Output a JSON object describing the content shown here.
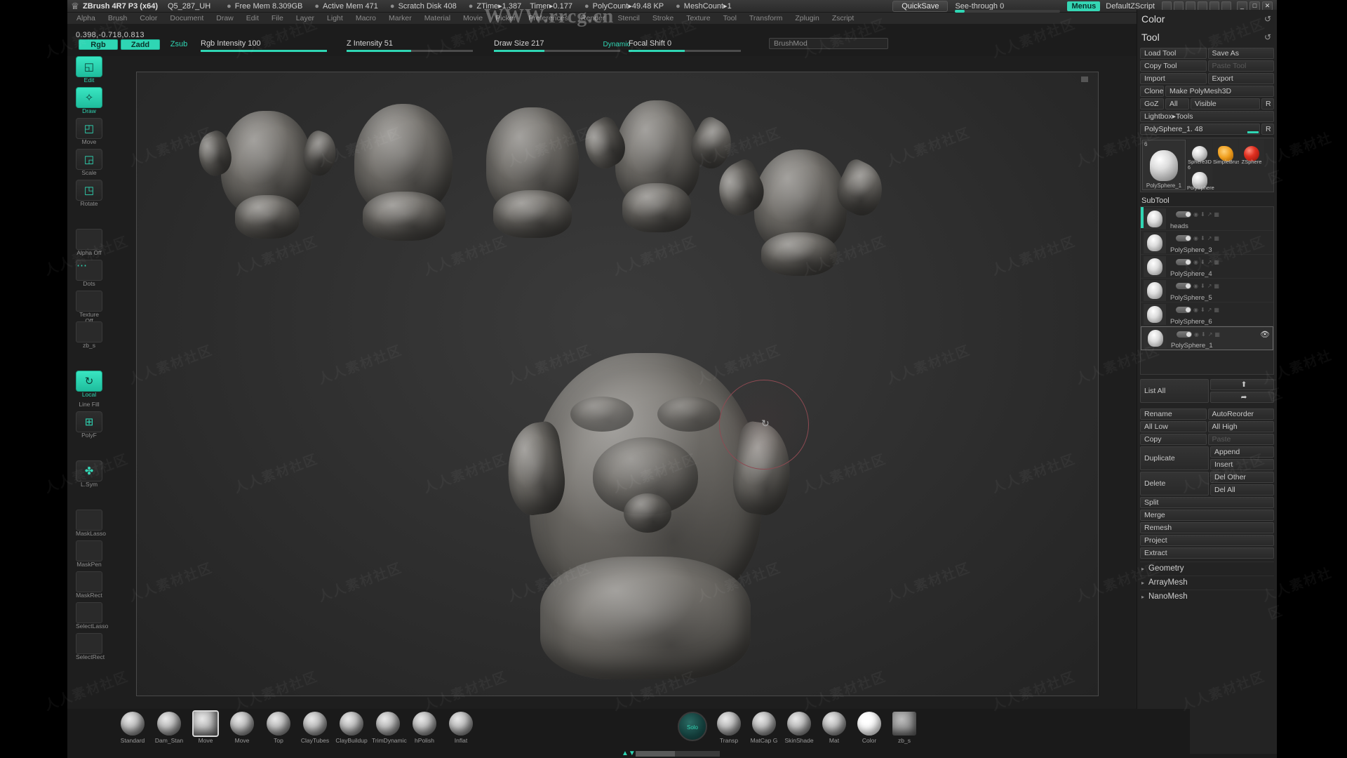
{
  "titlebar": {
    "app": "ZBrush 4R7 P3 (x64)",
    "project": "Q5_287_UH",
    "free_mem": "Free Mem 8.309GB",
    "active_mem": "Active Mem 471",
    "scratch_disk": "Scratch Disk 408",
    "ztime": "ZTime▸1.387",
    "timer": "Timer▸0.177",
    "polycount": "PolyCount▸49.48 KP",
    "meshcount": "MeshCount▸1",
    "quicksave": "QuickSave",
    "see_through_label": "See-through",
    "see_through_value": "0",
    "menus": "Menus",
    "zscript": "DefaultZScript",
    "win_min": "_",
    "win_max": "□",
    "win_close": "✕"
  },
  "menubar": {
    "items": [
      "Alpha",
      "Brush",
      "Color",
      "Document",
      "Draw",
      "Edit",
      "File",
      "Layer",
      "Light",
      "Macro",
      "Marker",
      "Material",
      "Movie",
      "Picker",
      "Preferences",
      "Render",
      "Stencil",
      "Stroke",
      "Texture",
      "Tool",
      "Transform",
      "Zplugin",
      "Zscript"
    ]
  },
  "watermark": {
    "url": "WWW.rrcg.cn",
    "tile": "人人素材社区"
  },
  "coords": "0.398,-0.718,0.813",
  "toolbar2": {
    "rgb": "Rgb",
    "zadd": "Zadd",
    "zsub": "Zsub",
    "rgb_intensity": "Rgb Intensity 100",
    "z_intensity": "Z Intensity 51",
    "draw_size": "Draw Size 217",
    "dynamic": "Dynamic",
    "focal_shift": "Focal Shift 0",
    "brushmod": "BrushMod"
  },
  "left_strip": {
    "items": [
      {
        "label": "Edit",
        "icon": "edit-icon",
        "glyph": "◱",
        "active": true,
        "type": "button"
      },
      {
        "label": "Draw",
        "icon": "draw-icon",
        "glyph": "✧",
        "active": true,
        "type": "button"
      },
      {
        "label": "Move",
        "icon": "move-icon",
        "glyph": "◰",
        "active": false,
        "type": "button"
      },
      {
        "label": "Scale",
        "icon": "scale-icon",
        "glyph": "◲",
        "active": false,
        "type": "button"
      },
      {
        "label": "Rotate",
        "icon": "rotate-icon",
        "glyph": "◳",
        "active": false,
        "type": "button"
      },
      {
        "label": "Alpha Off",
        "icon": "alpha-swatch",
        "glyph": "",
        "active": false,
        "type": "swatch"
      },
      {
        "label": "Dots",
        "icon": "stroke-dots-icon",
        "glyph": "⋯",
        "active": false,
        "type": "swatch"
      },
      {
        "label": "Texture Off",
        "icon": "texture-swatch",
        "glyph": "",
        "active": false,
        "type": "swatch"
      },
      {
        "label": "zb_s",
        "icon": "material-swatch",
        "glyph": "",
        "active": false,
        "type": "swatch"
      },
      {
        "label": "Local",
        "icon": "local-icon",
        "glyph": "↻",
        "active": true,
        "type": "button"
      },
      {
        "label": "Line Fill",
        "icon": "line-fill-label",
        "glyph": "",
        "active": false,
        "type": "text"
      },
      {
        "label": "PolyF",
        "icon": "polyframe-icon",
        "glyph": "⊞",
        "active": false,
        "type": "button"
      },
      {
        "label": "L.Sym",
        "icon": "lsym-icon",
        "glyph": "✤",
        "active": false,
        "type": "button"
      },
      {
        "label": "MaskLasso",
        "icon": "mask-lasso-icon",
        "glyph": "",
        "active": false,
        "type": "swatch"
      },
      {
        "label": "MaskPen",
        "icon": "mask-pen-icon",
        "glyph": "",
        "active": false,
        "type": "swatch"
      },
      {
        "label": "MaskRect",
        "icon": "mask-rect-icon",
        "glyph": "",
        "active": false,
        "type": "swatch"
      },
      {
        "label": "SelectLasso",
        "icon": "select-lasso-icon",
        "glyph": "",
        "active": false,
        "type": "swatch"
      },
      {
        "label": "SelectRect",
        "icon": "select-rect-icon",
        "glyph": "",
        "active": false,
        "type": "swatch"
      }
    ]
  },
  "color_panel": {
    "title": "Color",
    "reset": "↺"
  },
  "tool_panel": {
    "title": "Tool",
    "reset": "↺",
    "buttons": {
      "load_tool": "Load Tool",
      "save_as": "Save As",
      "copy_tool": "Copy Tool",
      "paste_tool": "Paste Tool",
      "import": "Import",
      "export": "Export",
      "clone": "Clone",
      "make_polymesh3d": "Make PolyMesh3D",
      "goz": "GoZ",
      "all": "All",
      "visible": "Visible",
      "r": "R",
      "lightbox_tools": "Lightbox▸Tools"
    },
    "current_tool": "PolySphere_1. 48",
    "current_tool_r": "R",
    "gallery": {
      "selected": {
        "name": "PolySphere_1",
        "num": "6"
      },
      "items": [
        {
          "name": "Sphere3D",
          "num": "",
          "ball": "white"
        },
        {
          "name": "SimpleBrush",
          "num": "",
          "ball": "org"
        },
        {
          "name": "ZSphere",
          "num": "",
          "ball": "red"
        },
        {
          "name": "PolySphere",
          "num": "6",
          "ball": "head"
        }
      ]
    }
  },
  "subtool_panel": {
    "title": "SubTool",
    "rows": [
      {
        "name": "heads",
        "selected": false
      },
      {
        "name": "PolySphere_3",
        "selected": false
      },
      {
        "name": "PolySphere_4",
        "selected": false
      },
      {
        "name": "PolySphere_5",
        "selected": false
      },
      {
        "name": "PolySphere_6",
        "selected": false
      },
      {
        "name": "PolySphere_1",
        "selected": true
      }
    ],
    "list_all": "List All",
    "up_arrow": "⬆",
    "fwd_arrow": "➦",
    "buttons": {
      "rename": "Rename",
      "autoreorder": "AutoReorder",
      "all_low": "All Low",
      "all_high": "All High",
      "copy": "Copy",
      "paste": "Paste",
      "duplicate": "Duplicate",
      "append": "Append",
      "insert": "Insert",
      "delete": "Delete",
      "del_other": "Del Other",
      "del_all": "Del All",
      "split": "Split",
      "merge": "Merge",
      "remesh": "Remesh",
      "project": "Project",
      "extract": "Extract"
    }
  },
  "sections": [
    "Geometry",
    "ArrayMesh",
    "NanoMesh"
  ],
  "bottom_bar": {
    "brushes": [
      {
        "label": "Standard",
        "selected": false
      },
      {
        "label": "Dam_Stan",
        "selected": false
      },
      {
        "label": "Move",
        "selected": true
      },
      {
        "label": "Move",
        "selected": false
      },
      {
        "label": "Top",
        "selected": false
      },
      {
        "label": "ClayTubes",
        "selected": false
      },
      {
        "label": "ClayBuildup",
        "selected": false
      },
      {
        "label": "TrimDynamic",
        "selected": false
      },
      {
        "label": "hPolish",
        "selected": false
      },
      {
        "label": "Inflat",
        "selected": false
      }
    ],
    "solo": "Solo",
    "extras": [
      {
        "label": "Transp"
      },
      {
        "label": "MatCap G"
      },
      {
        "label": "SkinShade"
      },
      {
        "label": "Mat"
      },
      {
        "label": "Color"
      },
      {
        "label": "zb_s"
      }
    ]
  },
  "viewport": {
    "heads_row": [
      {
        "name": "head-thumb-1"
      },
      {
        "name": "head-thumb-2"
      },
      {
        "name": "head-thumb-3"
      },
      {
        "name": "head-thumb-4"
      },
      {
        "name": "head-thumb-5"
      }
    ],
    "main_model": "main-sculpt-head",
    "brush_cursor": "brush-cursor-ring"
  }
}
